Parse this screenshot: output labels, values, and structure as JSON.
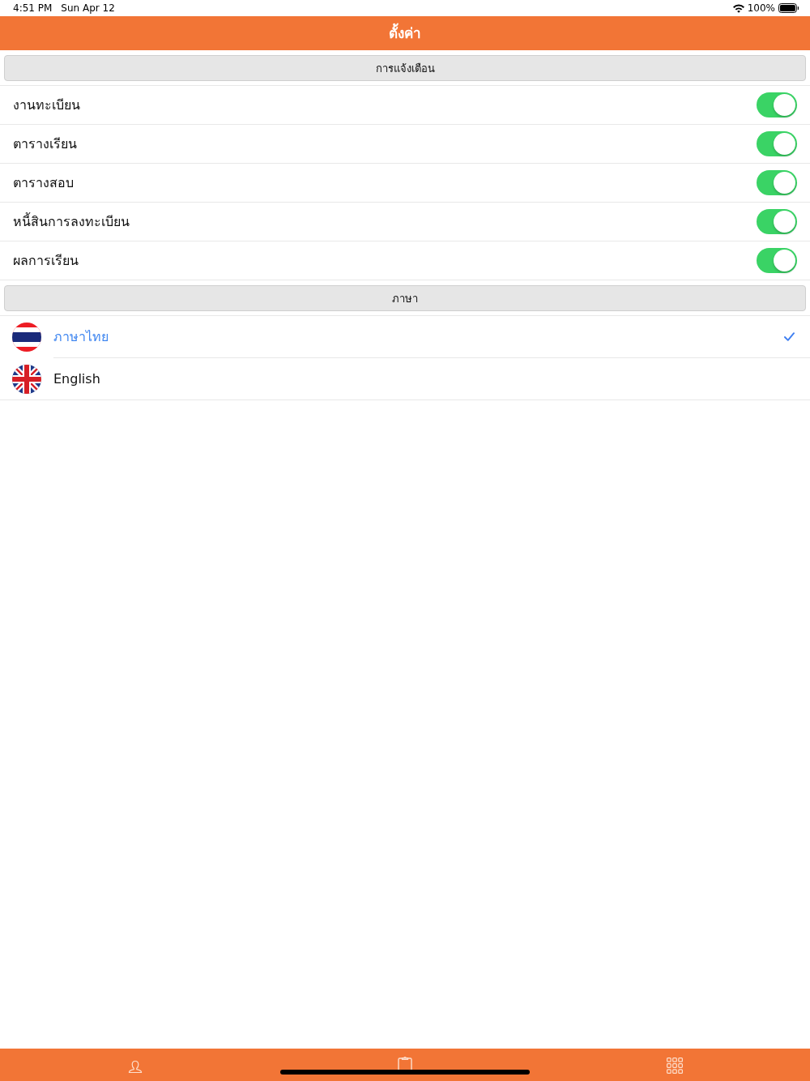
{
  "status_bar": {
    "time": "4:51 PM",
    "date": "Sun Apr 12",
    "battery": "100%"
  },
  "nav_bar": {
    "title": "ตั้งค่า"
  },
  "notifications": {
    "header": "การแจ้งเตือน",
    "items": [
      {
        "label": "งานทะเบียน",
        "on": true
      },
      {
        "label": "ตารางเรียน",
        "on": true
      },
      {
        "label": "ตารางสอบ",
        "on": true
      },
      {
        "label": "หนี้สินการลงทะเบียน",
        "on": true
      },
      {
        "label": "ผลการเรียน",
        "on": true
      }
    ]
  },
  "languages": {
    "header": "ภาษา",
    "items": [
      {
        "label": "ภาษาไทย",
        "kind": "thailand",
        "selected": true
      },
      {
        "label": "English",
        "kind": "uk",
        "selected": false
      }
    ]
  },
  "tab_bar": {
    "items": [
      {
        "kind": "person"
      },
      {
        "kind": "clipboard"
      },
      {
        "kind": "grid"
      }
    ]
  }
}
